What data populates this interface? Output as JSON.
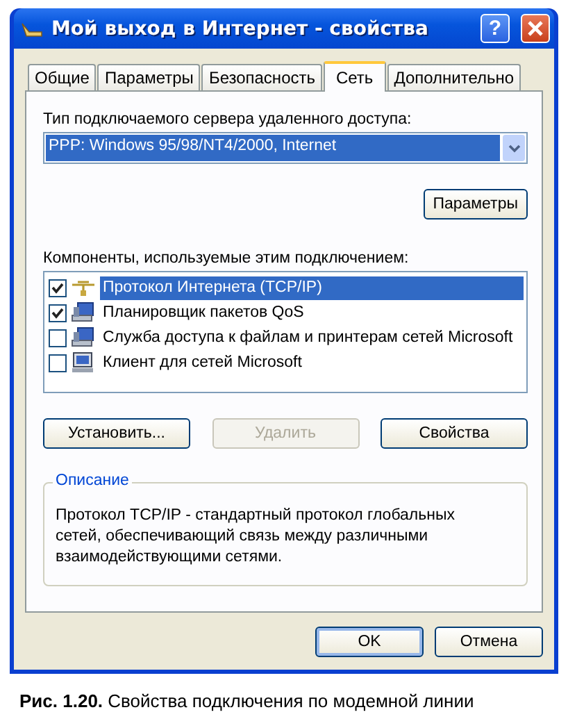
{
  "window": {
    "title": "Мой выход в Интернет - свойства",
    "help_button": "?"
  },
  "tabs": [
    {
      "label": "Общие",
      "selected": false
    },
    {
      "label": "Параметры",
      "selected": false
    },
    {
      "label": "Безопасность",
      "selected": false
    },
    {
      "label": "Сеть",
      "selected": true
    },
    {
      "label": "Дополнительно",
      "selected": false
    }
  ],
  "server_type": {
    "label": "Тип подключаемого сервера удаленного доступа:",
    "value": "PPP: Windows 95/98/NT4/2000, Internet"
  },
  "settings_button": "Параметры",
  "components": {
    "label": "Компоненты, используемые этим подключением:",
    "items": [
      {
        "name": "Протокол Интернета (TCP/IP)",
        "checked": true,
        "selected": true,
        "kind": "protocol"
      },
      {
        "name": "Планировщик пакетов QoS",
        "checked": true,
        "selected": false,
        "kind": "service"
      },
      {
        "name": "Служба доступа к файлам и принтерам сетей Microsoft",
        "checked": false,
        "selected": false,
        "kind": "service"
      },
      {
        "name": "Клиент для сетей Microsoft",
        "checked": false,
        "selected": false,
        "kind": "client"
      }
    ]
  },
  "component_buttons": [
    {
      "label": "Установить...",
      "disabled": false
    },
    {
      "label": "Удалить",
      "disabled": true
    },
    {
      "label": "Свойства",
      "disabled": false
    }
  ],
  "description": {
    "title": "Описание",
    "text": "Протокол TCP/IP - стандартный протокол глобальных сетей, обеспечивающий связь между различными взаимодействующими сетями."
  },
  "buttons": [
    "OK",
    "Отмена"
  ],
  "caption": {
    "number": "Рис. 1.20.",
    "text": "Свойства подключения по модемной линии"
  }
}
